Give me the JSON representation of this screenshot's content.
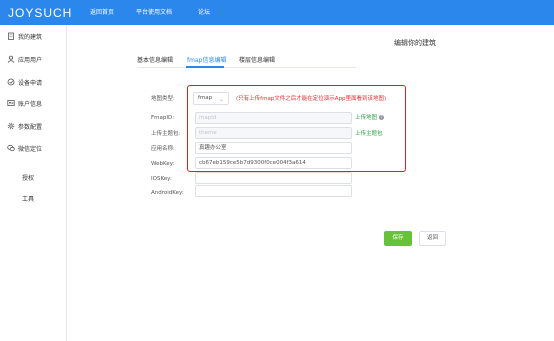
{
  "app": {
    "logo_text": "JOYSUCH"
  },
  "topnav": {
    "items": [
      {
        "label": "返回首页"
      },
      {
        "label": "平台使用文档"
      },
      {
        "label": "论坛"
      }
    ]
  },
  "sidebar": {
    "items": [
      {
        "label": "我的建筑",
        "icon": "building-icon"
      },
      {
        "label": "应用用户",
        "icon": "user-icon"
      },
      {
        "label": "设备申请",
        "icon": "device-icon"
      },
      {
        "label": "账户信息",
        "icon": "account-icon"
      },
      {
        "label": "参数配置",
        "icon": "gear-icon"
      },
      {
        "label": "微信定位",
        "icon": "wechat-icon"
      },
      {
        "label": "授权",
        "icon": ""
      },
      {
        "label": "工具",
        "icon": ""
      }
    ]
  },
  "page": {
    "title": "编辑你的建筑"
  },
  "tabs": [
    {
      "label": "基本信息编辑"
    },
    {
      "label": "fmap信息编辑",
      "active": true
    },
    {
      "label": "楼层信息编辑"
    }
  ],
  "form": {
    "map_type": {
      "label": "地图类型:",
      "value": "fmap",
      "warning": "(只有上传fmap文件之后才能在定位演示App里面看到该地图)"
    },
    "fmap_id": {
      "label": "FmapID:",
      "placeholder": "mapId",
      "link": "上传地图"
    },
    "theme_pack": {
      "label": "上传主题包:",
      "placeholder": "theme",
      "link": "上传主题包"
    },
    "app_name": {
      "label": "应用名称:",
      "value": "真趣办公室"
    },
    "web_key": {
      "label": "WebKey:",
      "value": "cb67eb159ce5b7d9300f0ce004f3a614"
    },
    "ios_key": {
      "label": "IOSKey:",
      "value": ""
    },
    "android_key": {
      "label": "AndroidKey:",
      "value": ""
    }
  },
  "actions": {
    "save_label": "保存",
    "back_label": "返回"
  },
  "colors": {
    "topbar": "#2b87ec",
    "accent": "#2b87ec",
    "warning": "#e03030",
    "link": "#2aa147",
    "save": "#67c23a"
  }
}
